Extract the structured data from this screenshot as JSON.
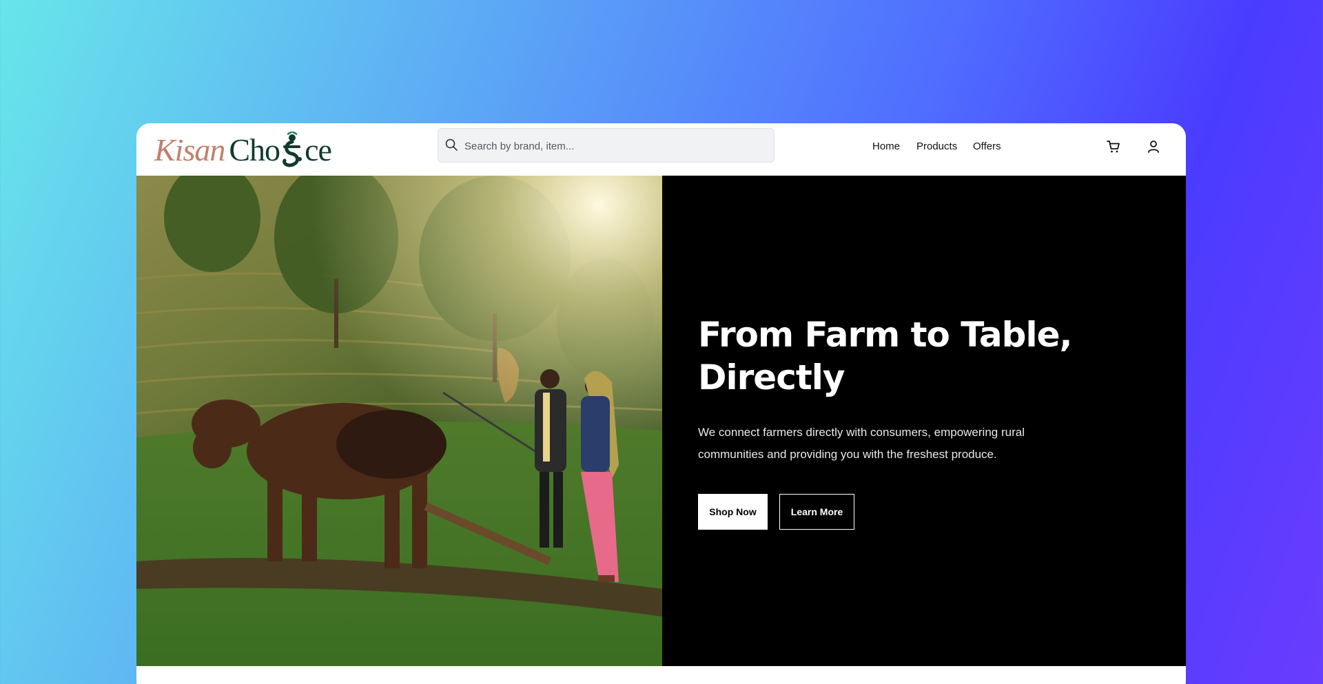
{
  "brand": {
    "name_part1": "Kisan",
    "name_part2a": "Cho",
    "name_part2b": "ce"
  },
  "search": {
    "placeholder": "Search by brand, item...",
    "icon": "search-icon"
  },
  "nav": {
    "items": [
      {
        "label": "Home"
      },
      {
        "label": "Products"
      },
      {
        "label": "Offers"
      }
    ]
  },
  "icons": {
    "cart": "cart-icon",
    "account": "user-icon"
  },
  "hero": {
    "title_line1": "From Farm to Table,",
    "title_line2": "Directly",
    "description_line1": "We connect farmers directly with consumers, empowering rural",
    "description_line2": "communities and providing you with the freshest produce.",
    "primary_button": "Shop Now",
    "secondary_button": "Learn More"
  },
  "colors": {
    "brand_kisan": "#c0806d",
    "brand_choice": "#123a2f",
    "hero_background": "#000000"
  }
}
